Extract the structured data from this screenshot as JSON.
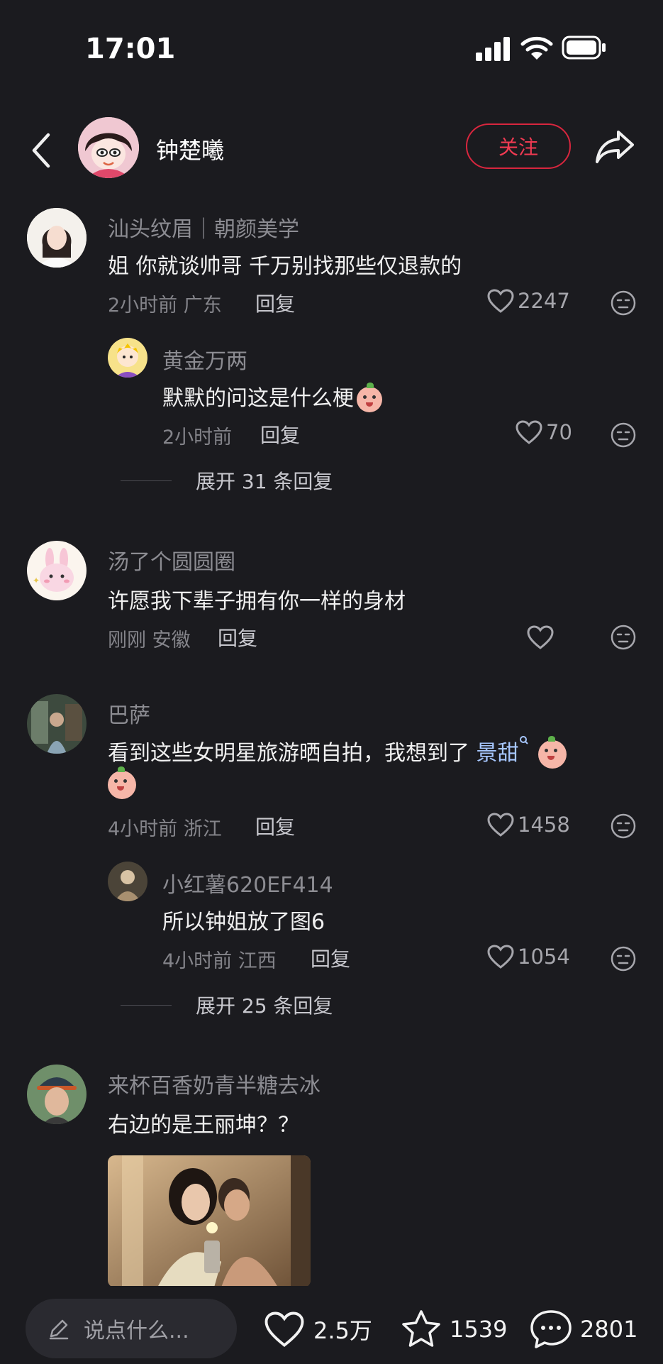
{
  "status_bar": {
    "time": "17:01"
  },
  "header": {
    "author_name": "钟楚曦",
    "follow_label": "关注"
  },
  "comments": [
    {
      "user": "汕头纹眉｜朝颜美学",
      "text": "姐 你就谈帅哥 千万别找那些仅退款的",
      "meta": "2小时前 广东",
      "reply_label": "回复",
      "likes": "2247",
      "replies": [
        {
          "user": "黄金万两",
          "text": "默默的问这是什么梗",
          "meta": "2小时前",
          "reply_label": "回复",
          "likes": "70"
        }
      ],
      "expand_label": "展开 31 条回复"
    },
    {
      "user": "汤了个圆圆圈",
      "text": "许愿我下辈子拥有你一样的身材",
      "meta": "刚刚 安徽",
      "reply_label": "回复",
      "likes": ""
    },
    {
      "user": "巴萨",
      "text": "看到这些女明星旅游晒自拍，我想到了",
      "tag": "景甜",
      "meta": "4小时前 浙江",
      "reply_label": "回复",
      "likes": "1458",
      "replies": [
        {
          "user": "小红薯620EF414",
          "text": "所以钟姐放了图6",
          "meta": "4小时前 江西",
          "reply_label": "回复",
          "likes": "1054"
        }
      ],
      "expand_label": "展开 25 条回复"
    },
    {
      "user": "来杯百香奶青半糖去冰",
      "text": "右边的是王丽坤？？"
    }
  ],
  "bottom_bar": {
    "input_placeholder": "说点什么...",
    "likes": "2.5万",
    "favorites": "1539",
    "comments": "2801"
  },
  "colors": {
    "background": "#1b1b1f",
    "accent": "#d8263e",
    "tag": "#a7c7ff"
  },
  "icons": [
    "back-icon",
    "share-icon",
    "heart-icon",
    "dislike-face-icon",
    "pencil-icon",
    "star-icon",
    "chat-bubble-icon",
    "search-small-icon"
  ]
}
